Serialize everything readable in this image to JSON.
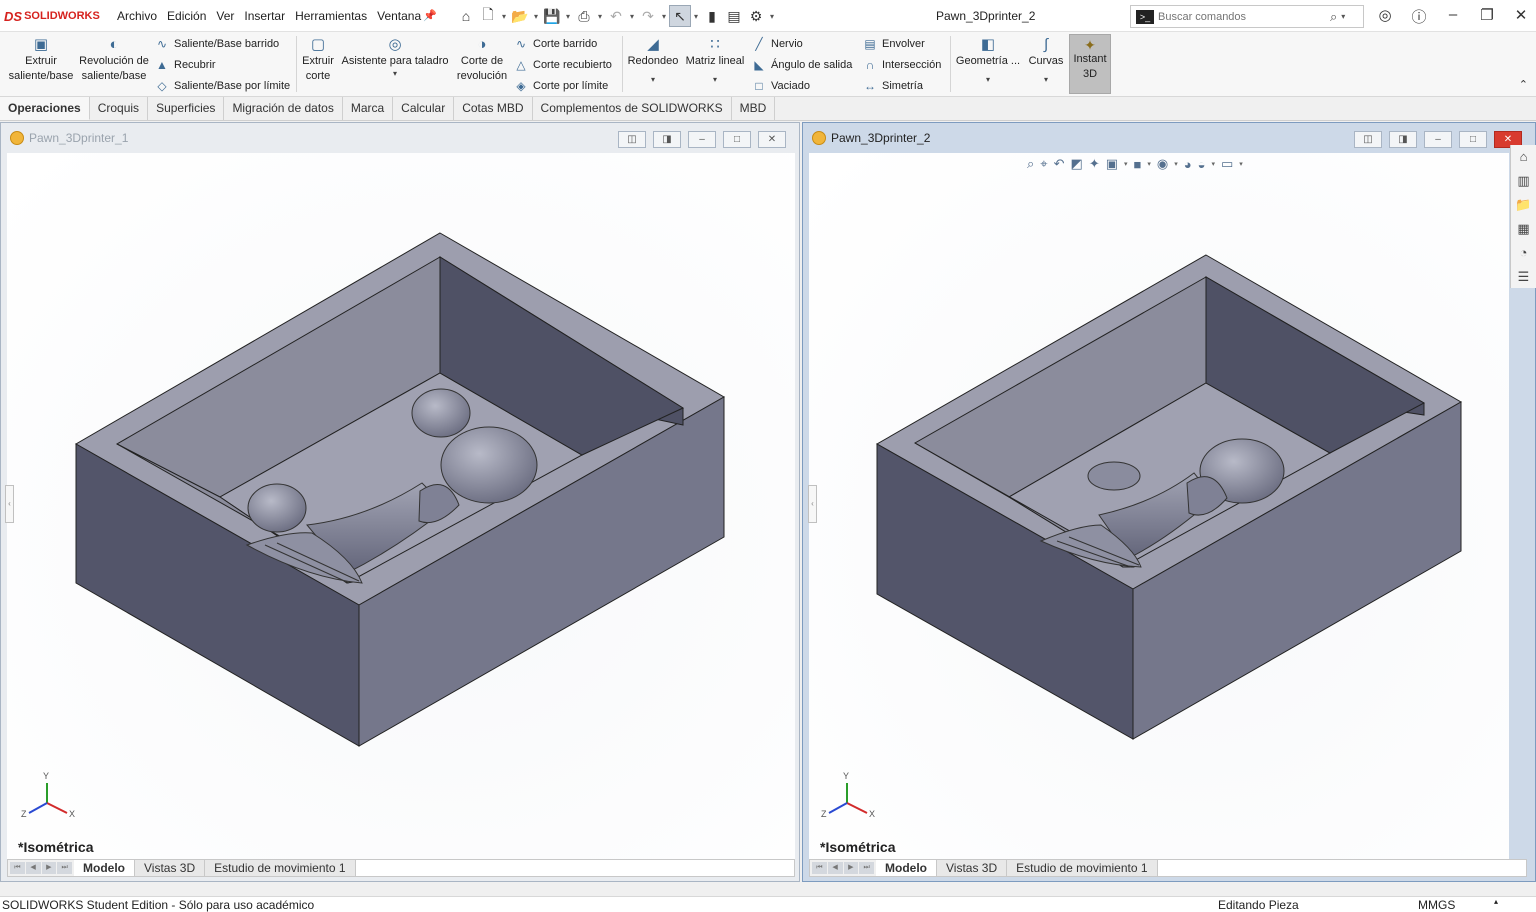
{
  "app": {
    "brand_mark": "DS",
    "brand_name": "SOLIDWORKS"
  },
  "menu": [
    "Archivo",
    "Edición",
    "Ver",
    "Insertar",
    "Herramientas",
    "Ventana"
  ],
  "document_title": "Pawn_3Dprinter_2",
  "search": {
    "placeholder": "Buscar comandos"
  },
  "ribbon": {
    "extrude_boss": "Extruir saliente/base",
    "revolve_boss": "Revolución de saliente/base",
    "swept_boss": "Saliente/Base barrido",
    "loft": "Recubrir",
    "boundary_boss": "Saliente/Base por límite",
    "extrude_cut": "Extruir corte",
    "hole_wizard": "Asistente para taladro",
    "revolve_cut": "Corte de revolución",
    "swept_cut": "Corte barrido",
    "lofted_cut": "Corte recubierto",
    "boundary_cut": "Corte por límite",
    "fillet": "Redondeo",
    "linear_pattern": "Matriz lineal",
    "rib": "Nervio",
    "draft": "Ángulo de salida",
    "shell": "Vaciado",
    "wrap": "Envolver",
    "intersect": "Intersección",
    "mirror": "Simetría",
    "ref_geometry": "Geometría ...",
    "curves": "Curvas",
    "instant3d": "Instant 3D"
  },
  "command_tabs": [
    "Operaciones",
    "Croquis",
    "Superficies",
    "Migración de datos",
    "Marca",
    "Calcular",
    "Cotas MBD",
    "Complementos de SOLIDWORKS",
    "MBD"
  ],
  "windows": [
    {
      "title": "Pawn_3Dprinter_1",
      "view_name": "*Isométrica",
      "tabs": [
        "Modelo",
        "Vistas 3D",
        "Estudio de movimiento 1"
      ]
    },
    {
      "title": "Pawn_3Dprinter_2",
      "view_name": "*Isométrica",
      "tabs": [
        "Modelo",
        "Vistas 3D",
        "Estudio de movimiento 1"
      ]
    }
  ],
  "triad": {
    "x": "X",
    "y": "Y",
    "z": "Z"
  },
  "status": {
    "edition": "SOLIDWORKS Student Edition - Sólo para uso académico",
    "mode": "Editando Pieza",
    "units": "MMGS"
  },
  "colors": {
    "model_face_light": "#9d9eae",
    "model_face_mid": "#74768a",
    "model_face_dark": "#53556a",
    "brand": "#d6221e",
    "active_window_frame": "#cdd9e8"
  }
}
